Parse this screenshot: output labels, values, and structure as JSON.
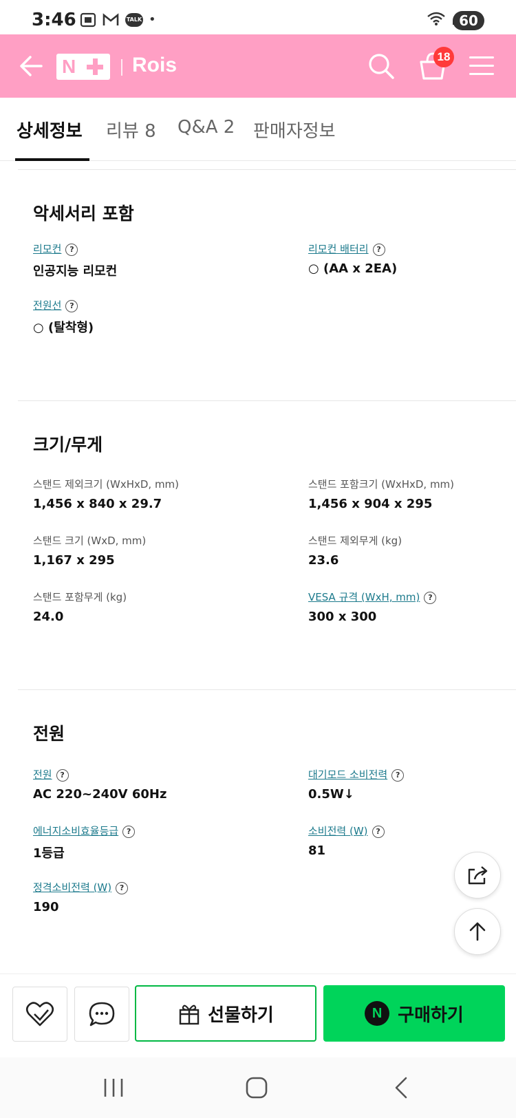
{
  "status_bar": {
    "time": "3:46",
    "battery": "60",
    "talk_icon_text": "TALK"
  },
  "header": {
    "logo_n": "N",
    "store_name": "Rois",
    "cart_count": "18",
    "background_color": "#ff9fc4"
  },
  "tabs": [
    {
      "label": "상세정보",
      "active": true
    },
    {
      "label": "리뷰 8",
      "active": false
    },
    {
      "label": "Q&A 2",
      "active": false
    },
    {
      "label": "판매자정보",
      "active": false
    }
  ],
  "sections": {
    "accessories": {
      "title": "악세서리 포함",
      "items": [
        {
          "label": "리모컨",
          "value": "인공지능 리모컨"
        },
        {
          "label": "리모컨 배터리",
          "value": "○ (AA x 2EA)"
        },
        {
          "label": "전원선",
          "value": "○ (탈착형)"
        }
      ]
    },
    "size_weight": {
      "title": "크기/무게",
      "items": [
        {
          "label": "스탠드 제외크기 (WxHxD, mm)",
          "value": "1,456 x 840 x 29.7"
        },
        {
          "label": "스탠드 포함크기 (WxHxD, mm)",
          "value": "1,456 x 904 x 295"
        },
        {
          "label": "스탠드 크기 (WxD, mm)",
          "value": "1,167 x 295"
        },
        {
          "label": "스탠드 제외무게 (kg)",
          "value": "23.6"
        },
        {
          "label": "스탠드 포함무게 (kg)",
          "value": "24.0"
        },
        {
          "label": "VESA 규격 (WxH, mm)",
          "value": "300 x 300"
        }
      ]
    },
    "power": {
      "title": "전원",
      "items": [
        {
          "label": "전원",
          "value": "AC 220~240V 60Hz"
        },
        {
          "label": "대기모드 소비전력",
          "value": "0.5W↓"
        },
        {
          "label": "에너지소비효율등급",
          "value": "1등급"
        },
        {
          "label": "소비전력 (W)",
          "value": "81"
        },
        {
          "label": "정격소비전력 (W)",
          "value": "190"
        }
      ]
    }
  },
  "help_icon": "?",
  "bottom_bar": {
    "gift_label": "선물하기",
    "buy_label": "구매하기",
    "buy_n": "N",
    "buy_color": "#00d45a",
    "gift_border_color": "#00b843"
  },
  "icons": {
    "back": "arrow-left-icon",
    "search": "search-icon",
    "cart": "cart-icon",
    "menu": "hamburger-icon",
    "wishlist": "heart-icon",
    "chat": "chat-icon",
    "gift": "gift-icon",
    "share": "share-icon",
    "scroll_top": "arrow-up-icon"
  }
}
